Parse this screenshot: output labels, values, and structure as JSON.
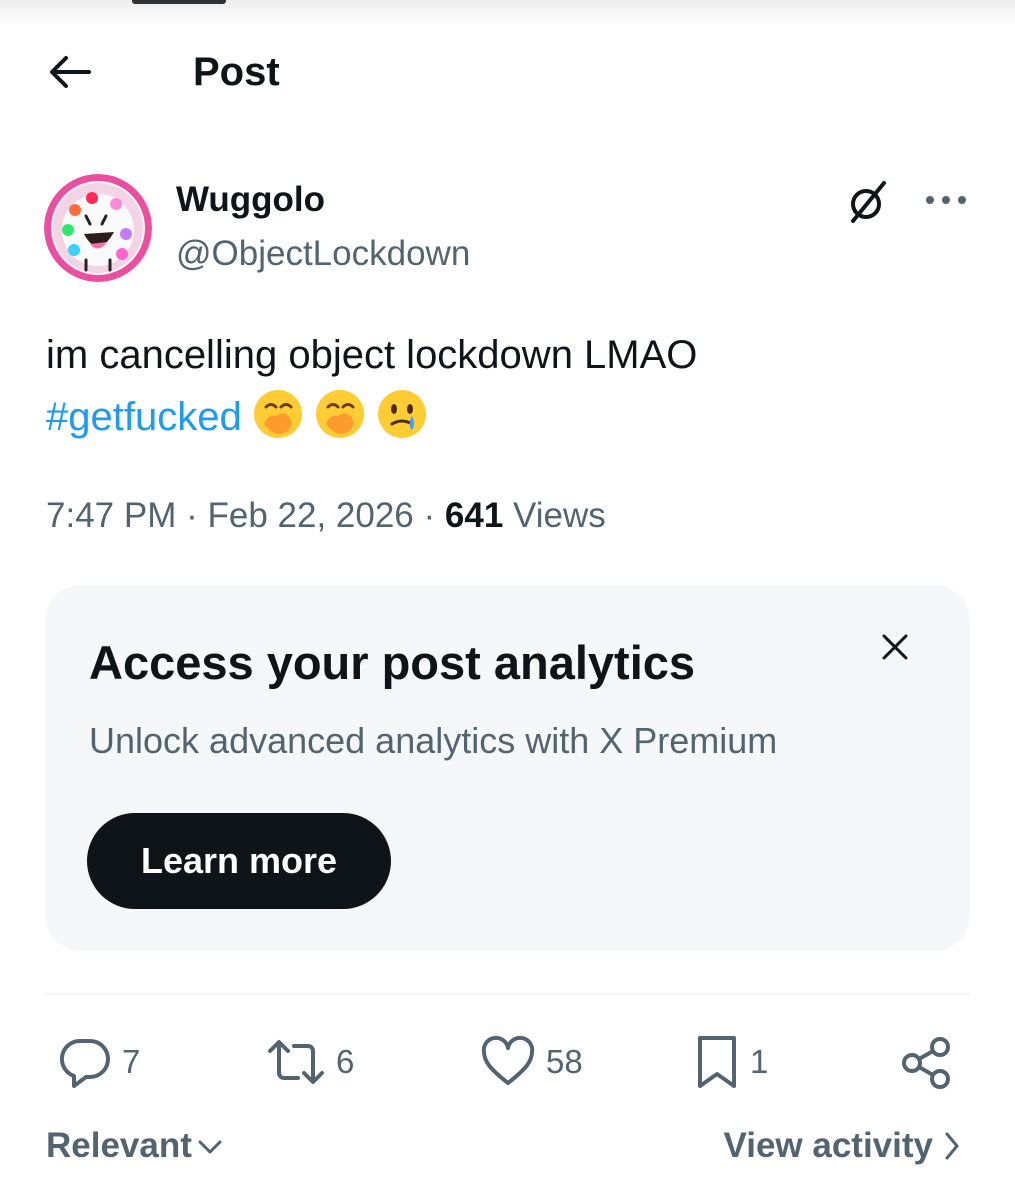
{
  "header": {
    "title": "Post"
  },
  "author": {
    "name": "Wuggolo",
    "handle": "@ObjectLockdown"
  },
  "post": {
    "text": "im cancelling object lockdown LMAO",
    "hashtag": "#getfucked",
    "emojis": [
      "face-with-hand-over-mouth",
      "face-with-hand-over-mouth",
      "face-holding-back-tears"
    ]
  },
  "meta": {
    "time": "7:47 PM",
    "separator": "·",
    "date": "Feb 22, 2026",
    "views_count": "641",
    "views_label": "Views"
  },
  "analytics_card": {
    "title": "Access your post analytics",
    "subtitle": "Unlock advanced analytics with X Premium",
    "button_label": "Learn more"
  },
  "actions": {
    "replies": "7",
    "reposts": "6",
    "likes": "58",
    "bookmarks": "1"
  },
  "footer": {
    "sort_label": "Relevant",
    "view_activity_label": "View activity"
  },
  "colors": {
    "accent": "#1d9bf0",
    "text_primary": "#0f1419",
    "text_secondary": "#536471",
    "card_bg": "#f5f7f8"
  }
}
